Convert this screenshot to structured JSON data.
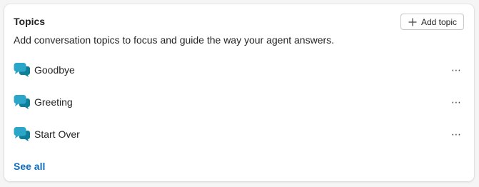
{
  "card": {
    "title": "Topics",
    "subtitle": "Add conversation topics to focus and guide the way your agent answers.",
    "add_button_label": "Add topic",
    "see_all_label": "See all"
  },
  "topics": [
    {
      "label": "Goodbye",
      "icon": "chat-bubbles-icon",
      "menu": "⋯"
    },
    {
      "label": "Greeting",
      "icon": "chat-bubbles-icon",
      "menu": "⋯"
    },
    {
      "label": "Start Over",
      "icon": "chat-bubbles-icon",
      "menu": "⋯"
    }
  ],
  "colors": {
    "icon_back_bubble": "#0e7f99",
    "icon_front_bubble": "#2ba6c9",
    "link": "#0f6cbd"
  }
}
